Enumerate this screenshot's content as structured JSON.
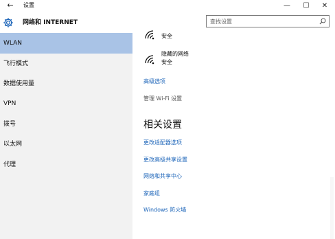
{
  "window": {
    "title": "设置",
    "back_glyph": "←",
    "minimize_glyph": "—",
    "maximize_glyph": "☐",
    "close_glyph": "✕"
  },
  "header": {
    "title": "网络和 INTERNET",
    "search_placeholder": "查找设置"
  },
  "sidebar": {
    "selected_index": 0,
    "items": [
      {
        "label": "WLAN"
      },
      {
        "label": "飞行模式"
      },
      {
        "label": "数据使用量"
      },
      {
        "label": "VPN"
      },
      {
        "label": "拨号"
      },
      {
        "label": "以太网"
      },
      {
        "label": "代理"
      }
    ]
  },
  "content": {
    "networks": [
      {
        "name": "",
        "status": "安全"
      },
      {
        "name": "隐藏的网络",
        "status": "安全"
      }
    ],
    "advanced_options": "高级选项",
    "manage_wifi": "管理 Wi-Fi 设置",
    "related_heading": "相关设置",
    "related_links": [
      {
        "label": "更改适配器选项"
      },
      {
        "label": "更改高级共享设置"
      },
      {
        "label": "网络和共享中心"
      },
      {
        "label": "家庭组"
      },
      {
        "label": "Windows 防火墙"
      }
    ]
  },
  "colors": {
    "accent_selected": "#a9c3e6",
    "link": "#1a63b8",
    "sidebar_bg": "#f2f2f2"
  }
}
